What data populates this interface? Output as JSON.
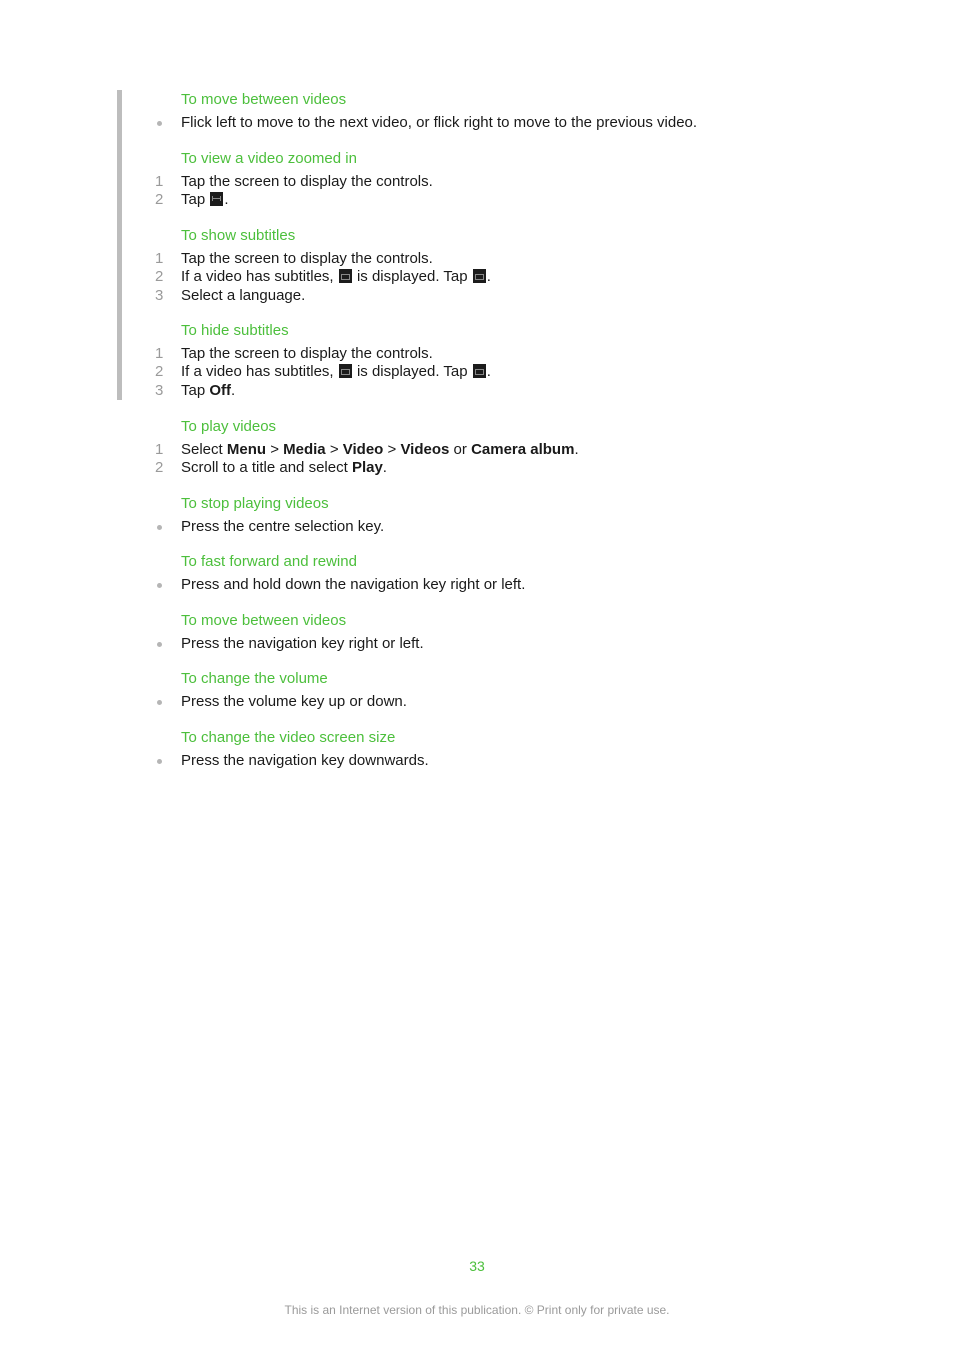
{
  "sections": [
    {
      "heading": "To move between videos",
      "items": [
        {
          "marker": "bullet",
          "text": "Flick left to move to the next video, or flick right to move to the previous video."
        }
      ]
    },
    {
      "heading": "To view a video zoomed in",
      "items": [
        {
          "marker": "1",
          "text": "Tap the screen to display the controls."
        },
        {
          "marker": "2",
          "pre": "Tap",
          "icon": "zoom-icon",
          "post": "."
        }
      ]
    },
    {
      "heading": "To show subtitles",
      "items": [
        {
          "marker": "1",
          "text": "Tap the screen to display the controls."
        },
        {
          "marker": "2",
          "pre": "If a video has subtitles,",
          "icon": "subtitles-icon",
          "mid": "is displayed. Tap",
          "icon2": "subtitles-icon",
          "post": "."
        },
        {
          "marker": "3",
          "text": "Select a language."
        }
      ]
    },
    {
      "heading": "To hide subtitles",
      "items": [
        {
          "marker": "1",
          "text": "Tap the screen to display the controls."
        },
        {
          "marker": "2",
          "pre": "If a video has subtitles,",
          "icon": "subtitles-icon",
          "mid": "is displayed. Tap",
          "icon2": "subtitles-icon",
          "post": "."
        },
        {
          "marker": "3",
          "pre": "Tap",
          "bold": "Off",
          "post": "."
        }
      ]
    },
    {
      "heading": "To play videos",
      "items": [
        {
          "marker": "1",
          "parts": [
            {
              "t": "Select ",
              "b": false
            },
            {
              "t": "Menu",
              "b": true
            },
            {
              "t": " > ",
              "b": false
            },
            {
              "t": "Media",
              "b": true
            },
            {
              "t": " > ",
              "b": false
            },
            {
              "t": "Video",
              "b": true
            },
            {
              "t": " > ",
              "b": false
            },
            {
              "t": "Videos",
              "b": true
            },
            {
              "t": " or ",
              "b": false
            },
            {
              "t": "Camera album",
              "b": true
            },
            {
              "t": ".",
              "b": false
            }
          ]
        },
        {
          "marker": "2",
          "pre": "Scroll to a title and select",
          "bold": "Play",
          "post": "."
        }
      ]
    },
    {
      "heading": "To stop playing videos",
      "items": [
        {
          "marker": "bullet",
          "text": "Press the centre selection key."
        }
      ]
    },
    {
      "heading": "To fast forward and rewind",
      "items": [
        {
          "marker": "bullet",
          "text": "Press and hold down the navigation key right or left."
        }
      ]
    },
    {
      "heading": "To move between videos",
      "items": [
        {
          "marker": "bullet",
          "text": "Press the navigation key right or left."
        }
      ]
    },
    {
      "heading": "To change the volume",
      "items": [
        {
          "marker": "bullet",
          "text": "Press the volume key up or down."
        }
      ]
    },
    {
      "heading": "To change the video screen size",
      "items": [
        {
          "marker": "bullet",
          "text": "Press the navigation key downwards."
        }
      ]
    }
  ],
  "page_number": "33",
  "footer": "This is an Internet version of this publication. © Print only for private use.",
  "colors": {
    "heading": "#4cbf3c",
    "sidebar_bar": "#bdbdbd",
    "footer": "#9a9a9a"
  }
}
